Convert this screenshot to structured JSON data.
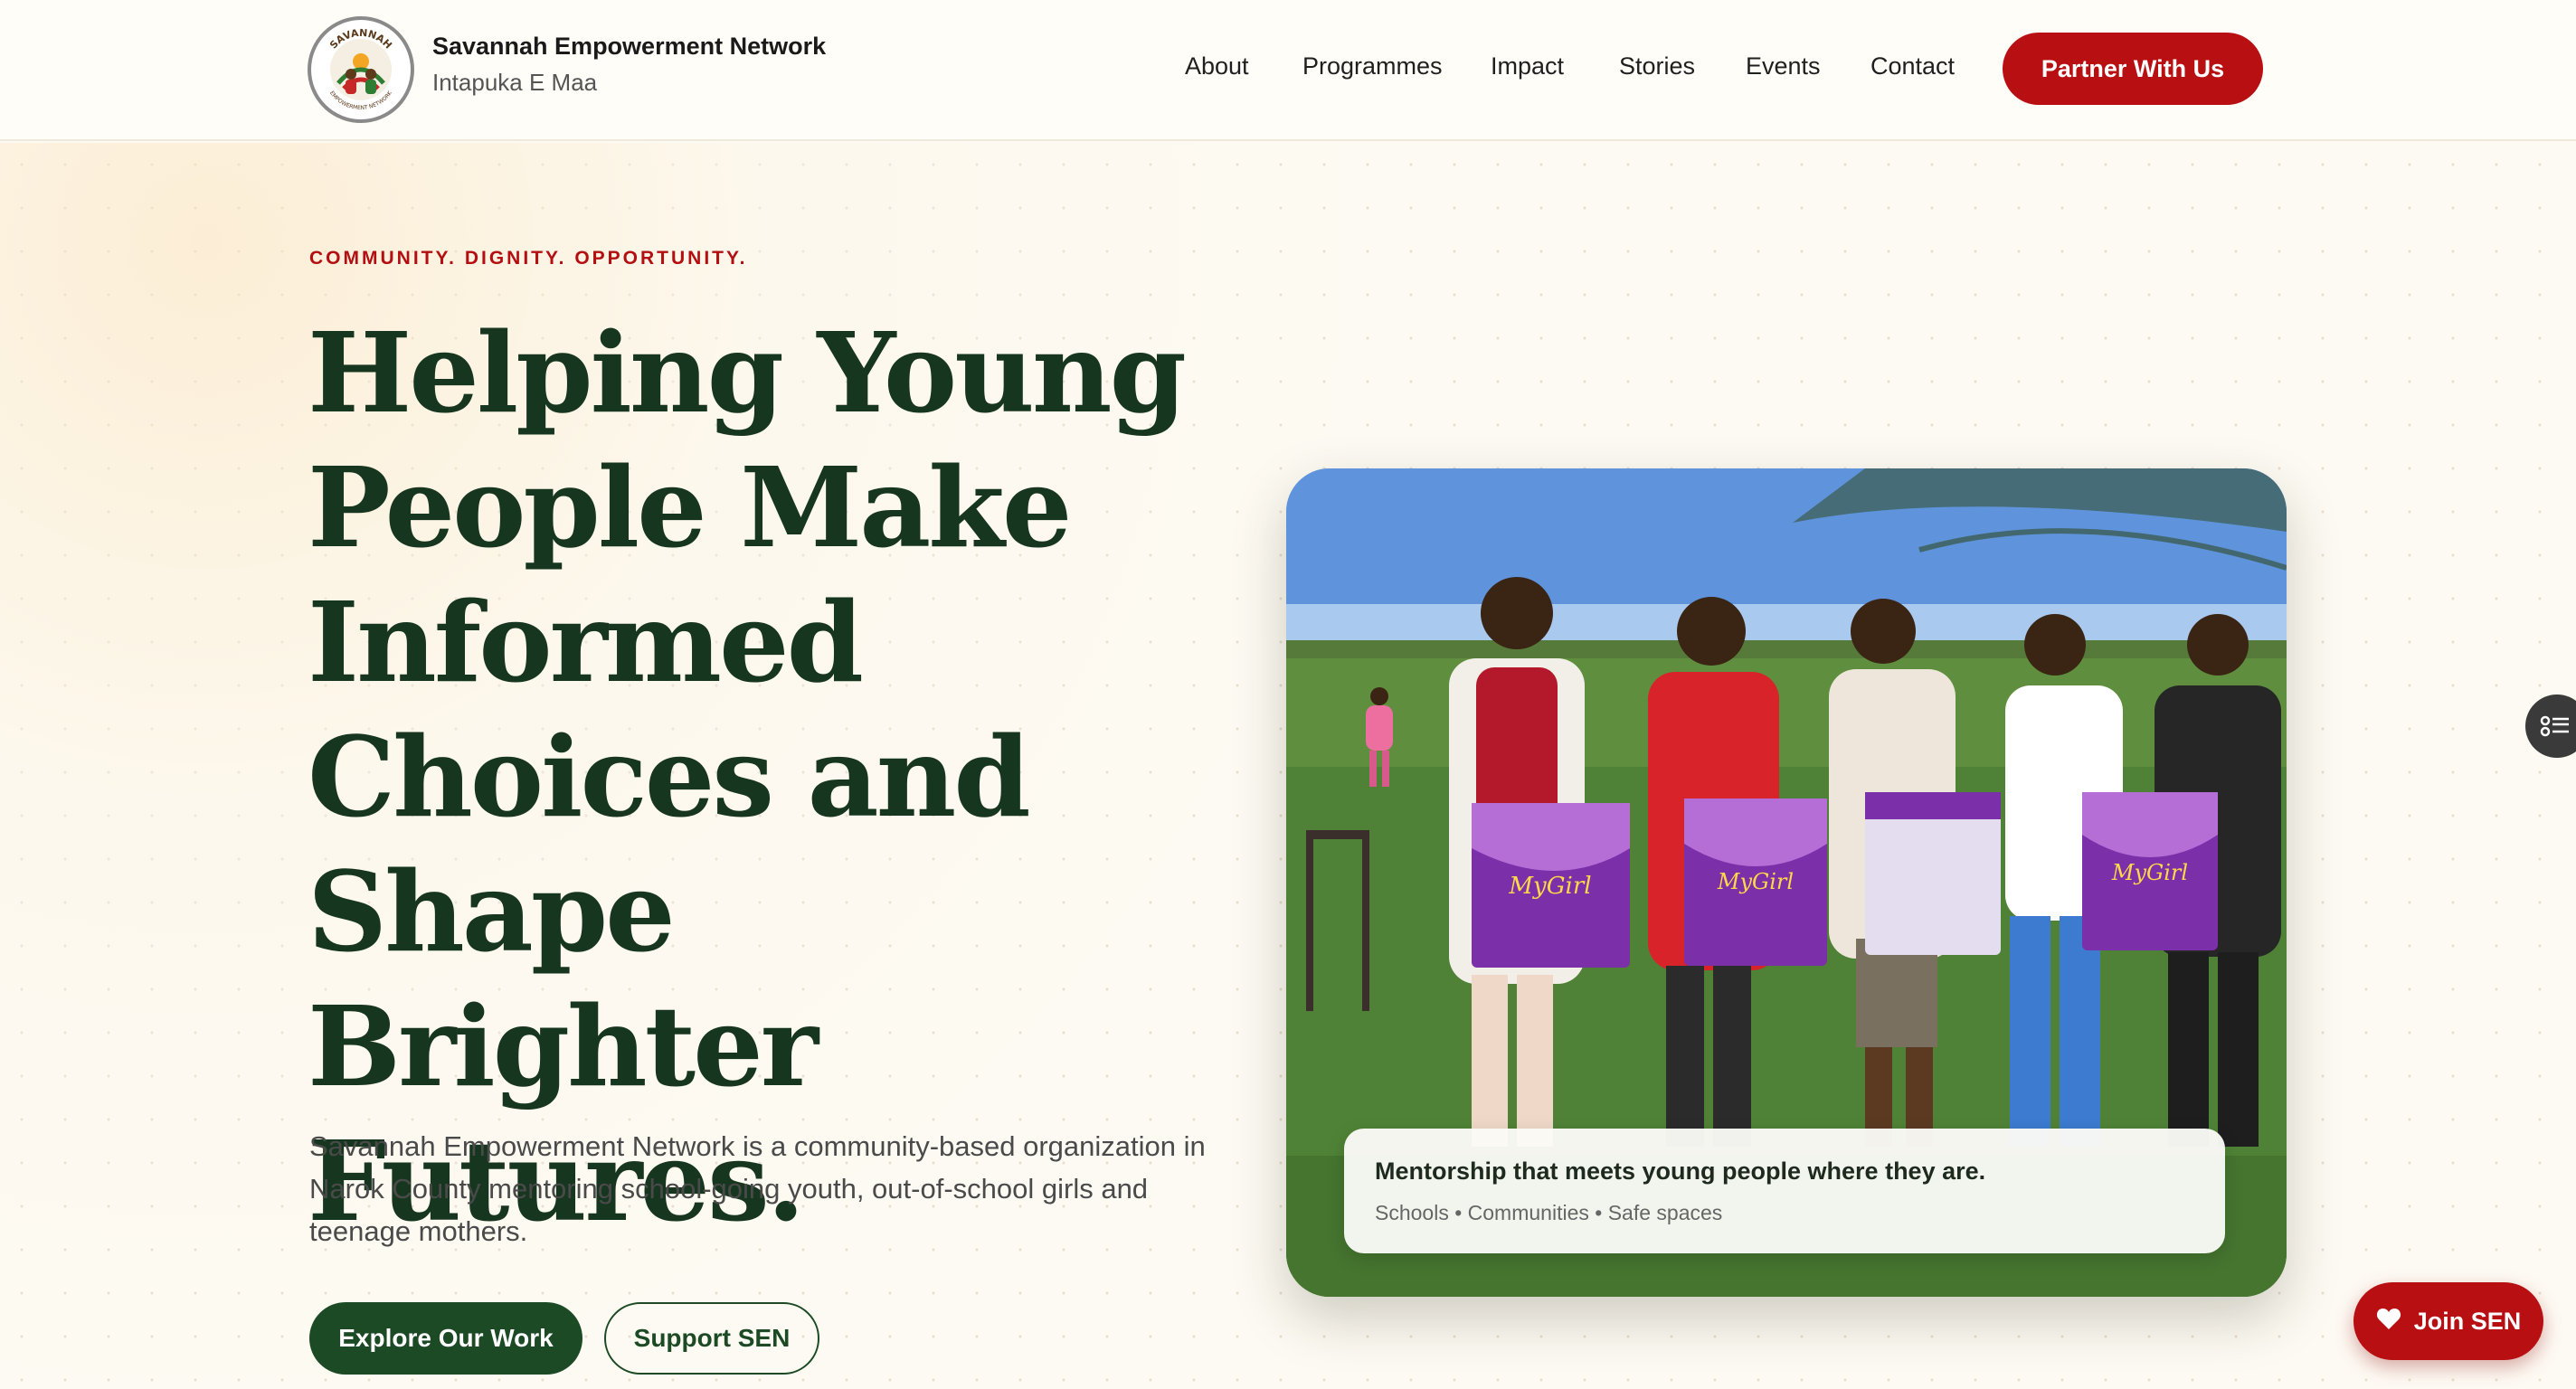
{
  "header": {
    "brand_name": "Savannah Empowerment Network",
    "brand_tagline": "Intapuka E Maa",
    "logo_icon": "savannah-logo-icon",
    "logo_ring_text": "SAVANNAH",
    "logo_ring_bottom_text": "EMPOWERMENT NETWORK",
    "nav": [
      {
        "label": "About"
      },
      {
        "label": "Programmes"
      },
      {
        "label": "Impact"
      },
      {
        "label": "Stories"
      },
      {
        "label": "Events"
      },
      {
        "label": "Contact"
      }
    ],
    "cta_label": "Partner With Us"
  },
  "hero": {
    "eyebrow": "COMMUNITY. DIGNITY. OPPORTUNITY.",
    "headline": "Helping Young People Make Informed Choices and Shape Brighter Futures.",
    "description": "Savannah Empowerment Network is a community-based organization in Narok County mentoring school-going youth, out-of-school girls and teenage mothers.",
    "primary_button": "Explore Our Work",
    "secondary_button": "Support SEN"
  },
  "photo": {
    "box_brand": "MyGirl",
    "caption_title": "Mentorship that meets young people where they are.",
    "caption_subtitle": "Schools • Communities • Safe spaces"
  },
  "floating": {
    "side_widget_icon": "accessibility-menu-icon",
    "join_label": "Join SEN",
    "join_icon": "heart-icon"
  },
  "colors": {
    "brand_red": "#b80f12",
    "brand_green": "#1c4a24",
    "headline_green": "#17361f",
    "background": "#fdfaf3"
  }
}
